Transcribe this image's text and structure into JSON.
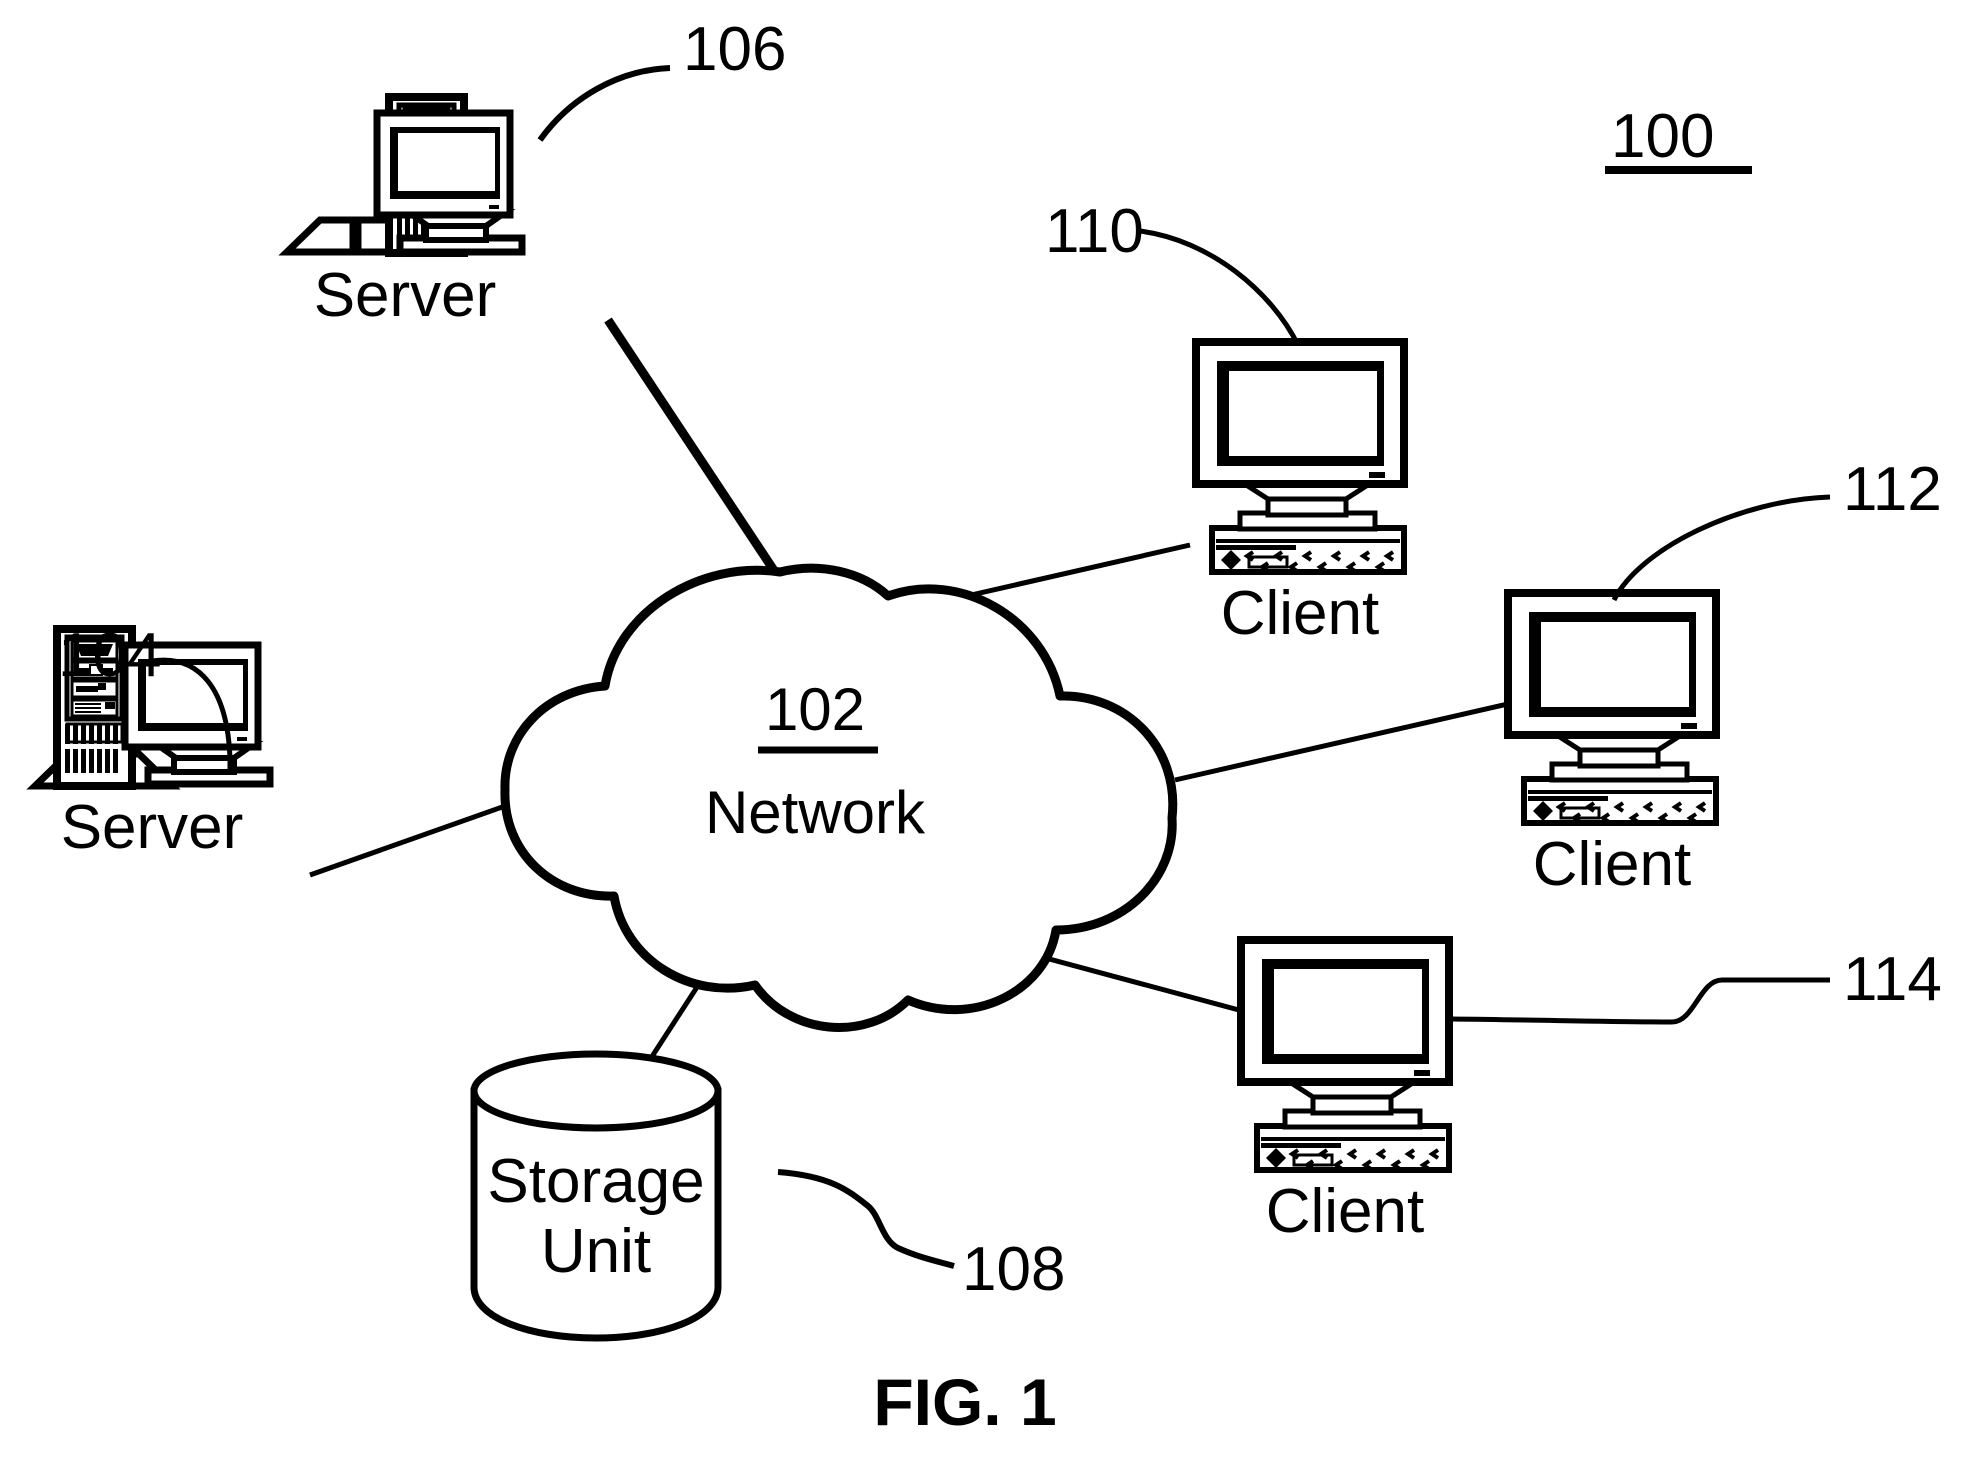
{
  "figure": {
    "caption": "FIG. 1",
    "system_ref": "100"
  },
  "network": {
    "ref": "102",
    "label": "Network",
    "icon": "cloud-icon"
  },
  "nodes": [
    {
      "id": "server-104",
      "ref": "104",
      "label": "Server",
      "type": "server",
      "icon": "server-tower-monitor-icon"
    },
    {
      "id": "server-106",
      "ref": "106",
      "label": "Server",
      "type": "server",
      "icon": "server-tower-monitor-icon"
    },
    {
      "id": "storage-108",
      "ref": "108",
      "label_line1": "Storage",
      "label_line2": "Unit",
      "type": "storage",
      "icon": "cylinder-database-icon"
    },
    {
      "id": "client-110",
      "ref": "110",
      "label": "Client",
      "type": "client",
      "icon": "desktop-workstation-icon"
    },
    {
      "id": "client-112",
      "ref": "112",
      "label": "Client",
      "type": "client",
      "icon": "desktop-workstation-icon"
    },
    {
      "id": "client-114",
      "ref": "114",
      "label": "Client",
      "type": "client",
      "icon": "desktop-workstation-icon"
    }
  ],
  "connections": [
    {
      "from": "server-106",
      "to": "network"
    },
    {
      "from": "server-104",
      "to": "network"
    },
    {
      "from": "storage-108",
      "to": "network"
    },
    {
      "from": "client-110",
      "to": "network"
    },
    {
      "from": "client-112",
      "to": "network"
    },
    {
      "from": "client-114",
      "to": "network"
    }
  ],
  "colors": {
    "ink": "#000000",
    "paper": "#ffffff"
  }
}
